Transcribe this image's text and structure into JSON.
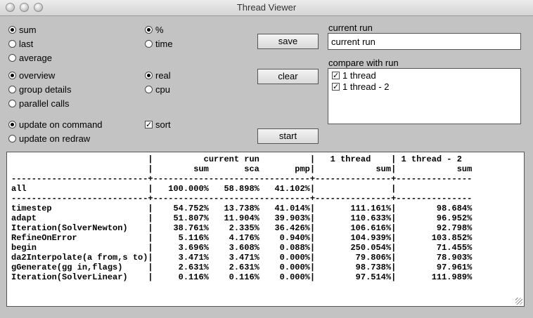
{
  "window": {
    "title": "Thread Viewer"
  },
  "options": {
    "mode": [
      {
        "label": "sum",
        "selected": true
      },
      {
        "label": "last",
        "selected": false
      },
      {
        "label": "average",
        "selected": false
      }
    ],
    "unit": [
      {
        "label": "%",
        "selected": true
      },
      {
        "label": "time",
        "selected": false
      }
    ],
    "view": [
      {
        "label": "overview",
        "selected": true
      },
      {
        "label": "group details",
        "selected": false
      },
      {
        "label": "parallel calls",
        "selected": false
      }
    ],
    "clock": [
      {
        "label": "real",
        "selected": true
      },
      {
        "label": "cpu",
        "selected": false
      }
    ],
    "update": [
      {
        "label": "update on command",
        "selected": true
      },
      {
        "label": "update on redraw",
        "selected": false
      }
    ],
    "sort": {
      "label": "sort",
      "checked": true
    }
  },
  "buttons": {
    "save": "save",
    "clear": "clear",
    "start": "start"
  },
  "current_run": {
    "label": "current run",
    "value": "current run"
  },
  "compare": {
    "label": "compare with run",
    "runs": [
      {
        "label": "1 thread",
        "checked": true
      },
      {
        "label": "1 thread - 2",
        "checked": true
      }
    ]
  },
  "report": {
    "header": {
      "current_run": "current run",
      "run2": "1 thread",
      "run3": "1 thread - 2"
    },
    "columns": {
      "sum": "sum",
      "sca": "sca",
      "pmp": "pmp",
      "run2_sum": "sum",
      "run3_sum": "sum"
    },
    "total": {
      "name": "all",
      "sum": "100.000%",
      "sca": "58.898%",
      "pmp": "41.102%",
      "run2": "",
      "run3": ""
    },
    "rows": [
      {
        "name": "timestep",
        "sum": "54.752%",
        "sca": "13.738%",
        "pmp": "41.014%",
        "run2": "111.161%",
        "run3": "98.684%"
      },
      {
        "name": "adapt",
        "sum": "51.807%",
        "sca": "11.904%",
        "pmp": "39.903%",
        "run2": "110.633%",
        "run3": "96.952%"
      },
      {
        "name": "Iteration(SolverNewton)",
        "sum": "38.761%",
        "sca": "2.335%",
        "pmp": "36.426%",
        "run2": "106.616%",
        "run3": "92.798%"
      },
      {
        "name": "RefineOnError",
        "sum": "5.116%",
        "sca": "4.176%",
        "pmp": "0.940%",
        "run2": "104.939%",
        "run3": "103.852%"
      },
      {
        "name": "begin",
        "sum": "3.696%",
        "sca": "3.608%",
        "pmp": "0.088%",
        "run2": "250.054%",
        "run3": "71.455%"
      },
      {
        "name": "da2Interpolate(a from,s to)",
        "sum": "3.471%",
        "sca": "3.471%",
        "pmp": "0.000%",
        "run2": "79.806%",
        "run3": "78.903%"
      },
      {
        "name": "gGenerate(gg in,flags)",
        "sum": "2.631%",
        "sca": "2.631%",
        "pmp": "0.000%",
        "run2": "98.738%",
        "run3": "97.961%"
      },
      {
        "name": "Iteration(SolverLinear)",
        "sum": "0.116%",
        "sca": "0.116%",
        "pmp": "0.000%",
        "run2": "97.514%",
        "run3": "111.989%"
      }
    ]
  }
}
